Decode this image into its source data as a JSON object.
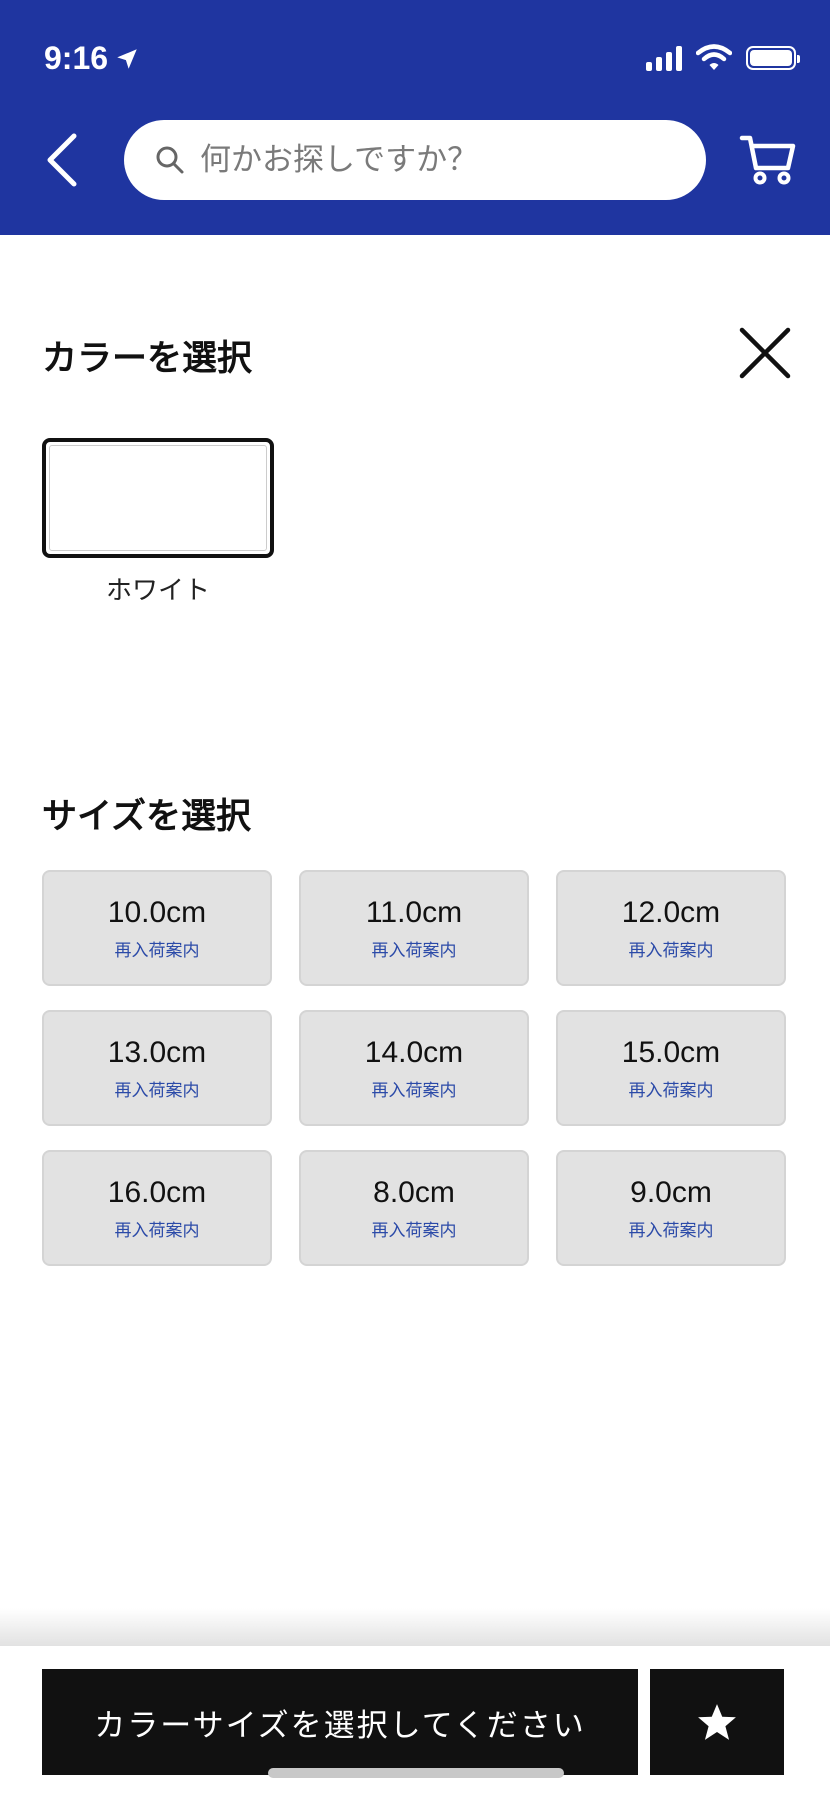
{
  "status_bar": {
    "time": "9:16"
  },
  "header": {
    "search": {
      "placeholder": "何かお探しですか？"
    }
  },
  "color_section": {
    "title": "カラーを選択",
    "options": [
      {
        "label": "ホワイト",
        "color": "#ffffff"
      }
    ]
  },
  "size_section": {
    "title": "サイズを選択",
    "sizes": [
      {
        "label": "10.0cm",
        "sub": "再入荷案内"
      },
      {
        "label": "11.0cm",
        "sub": "再入荷案内"
      },
      {
        "label": "12.0cm",
        "sub": "再入荷案内"
      },
      {
        "label": "13.0cm",
        "sub": "再入荷案内"
      },
      {
        "label": "14.0cm",
        "sub": "再入荷案内"
      },
      {
        "label": "15.0cm",
        "sub": "再入荷案内"
      },
      {
        "label": "16.0cm",
        "sub": "再入荷案内"
      },
      {
        "label": "8.0cm",
        "sub": "再入荷案内"
      },
      {
        "label": "9.0cm",
        "sub": "再入荷案内"
      }
    ]
  },
  "bottom_bar": {
    "cta_label": "カラーサイズを選択してください"
  },
  "colors": {
    "header_bg": "#1f35a0",
    "restock_link": "#2b4aa8",
    "cta_bg": "#111111"
  },
  "icons": [
    "location-arrow-icon",
    "signal-icon",
    "wifi-icon",
    "battery-icon",
    "chevron-left-icon",
    "search-icon",
    "cart-icon",
    "close-icon",
    "star-icon"
  ]
}
